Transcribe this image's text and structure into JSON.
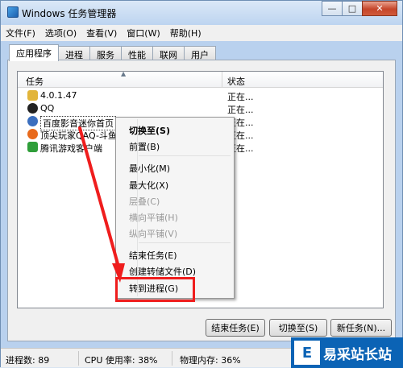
{
  "window": {
    "title": "Windows 任务管理器",
    "minimize": "—",
    "maximize": "□",
    "close": "✕"
  },
  "menubar": [
    "文件(F)",
    "选项(O)",
    "查看(V)",
    "窗口(W)",
    "帮助(H)"
  ],
  "tabs": [
    {
      "label": "应用程序",
      "active": true
    },
    {
      "label": "进程",
      "active": false
    },
    {
      "label": "服务",
      "active": false
    },
    {
      "label": "性能",
      "active": false
    },
    {
      "label": "联网",
      "active": false
    },
    {
      "label": "用户",
      "active": false
    }
  ],
  "list": {
    "col_task": "任务",
    "col_status": "状态",
    "sort_indicator": "▲",
    "rows": [
      {
        "name": "4.0.1.47",
        "status": "正在...",
        "icon": "folder-icon",
        "color": "#e2b53a"
      },
      {
        "name": "QQ",
        "status": "正在...",
        "icon": "qq-penguin-icon",
        "color": "#222222"
      },
      {
        "name": "百度影音迷你首页",
        "status": "正在...",
        "icon": "baidu-player-icon",
        "color": "#3b6fbf",
        "selected": true
      },
      {
        "name": "顶尖玩家QAQ-斗鱼",
        "status": "正在...",
        "icon": "browser-icon",
        "color": "#e86a1c"
      },
      {
        "name": "腾讯游戏客户端",
        "status": "正在...",
        "icon": "tencent-games-icon",
        "color": "#2f9e3a"
      }
    ]
  },
  "context_menu": [
    {
      "label": "切换至(S)",
      "bold": true
    },
    {
      "label": "前置(B)"
    },
    {
      "label": "最小化(M)"
    },
    {
      "label": "最大化(X)"
    },
    {
      "label": "层叠(C)",
      "disabled": true
    },
    {
      "label": "横向平铺(H)",
      "disabled": true
    },
    {
      "label": "纵向平铺(V)",
      "disabled": true
    },
    {
      "label": "结束任务(E)"
    },
    {
      "label": "创建转储文件(D)"
    },
    {
      "label": "转到进程(G)",
      "highlighted": true
    }
  ],
  "buttons": {
    "end_task": "结束任务(E)",
    "switch_to": "切换至(S)",
    "new_task": "新任务(N)..."
  },
  "statusbar": {
    "processes": "进程数: 89",
    "cpu": "CPU 使用率: 38%",
    "memory": "物理内存: 36%"
  },
  "watermark": {
    "logo_char": "E",
    "text": "易采站长站"
  },
  "colors": {
    "annotation_red": "#ef1d1d",
    "titlebar": "#bdd4f0",
    "watermark_blue": "#0b63b5"
  }
}
